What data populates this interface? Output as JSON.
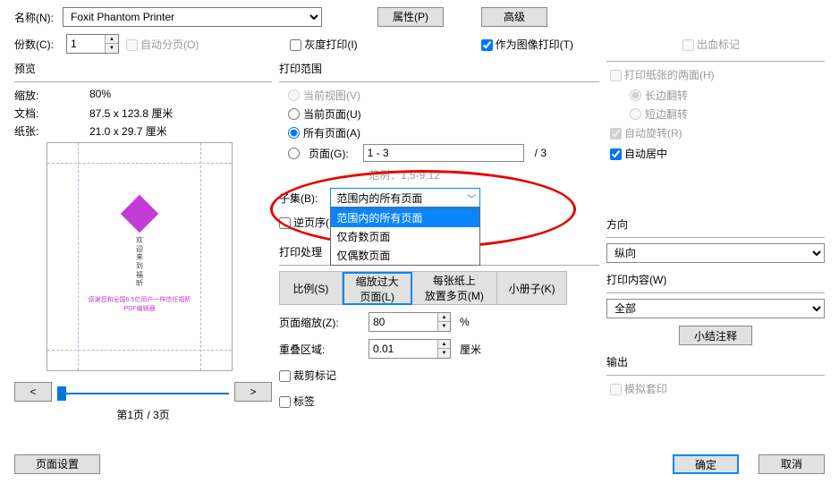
{
  "header": {
    "name_label": "名称(N):",
    "printer": "Foxit Phantom Printer",
    "properties_btn": "属性(P)",
    "advanced_btn": "高级",
    "copies_label": "份数(C):",
    "copies_value": "1",
    "collate_label": "自动分页(O)",
    "grayscale_label": "灰度打印(I)",
    "as_image_label": "作为图像打印(T)",
    "bleed_label": "出血标记"
  },
  "preview": {
    "title": "预览",
    "zoom_label": "缩放:",
    "zoom_value": "80%",
    "doc_label": "文档:",
    "doc_value": "87.5 x 123.8 厘米",
    "paper_label": "纸张:",
    "paper_value": "21.0 x 29.7 厘米",
    "nav_prev": "<",
    "nav_next": ">",
    "page_indicator": "第1页 / 3页"
  },
  "range": {
    "title": "打印范围",
    "current_view": "当前视图(V)",
    "current_page": "当前页面(U)",
    "all_pages": "所有页面(A)",
    "pages_label": "页面(G):",
    "pages_value": "1 - 3",
    "pages_total": "/ 3",
    "example_label": "范例：1,5-9,12",
    "subset_label": "子集(B):",
    "subset_selected": "范围内的所有页面",
    "subset_options": [
      "范围内的所有页面",
      "仅奇数页面",
      "仅偶数页面"
    ],
    "reverse_label": "逆页序(E)"
  },
  "handling": {
    "title": "打印处理",
    "tab_scale": "比例(S)",
    "tab_fit": "缩放过大\n页面(L)",
    "tab_multi": "每张纸上\n放置多页(M)",
    "tab_booklet": "小册子(K)",
    "page_zoom_label": "页面缩放(Z):",
    "page_zoom_value": "80",
    "page_zoom_unit": "%",
    "overlap_label": "重叠区域:",
    "overlap_value": "0.01",
    "overlap_unit": "厘米",
    "crop_label": "裁剪标记",
    "tags_label": "标签"
  },
  "duplex": {
    "both_sides": "打印纸张的两面(H)",
    "long_edge": "长边翻转",
    "short_edge": "短边翻转",
    "auto_rotate": "自动旋转(R)",
    "auto_center": "自动居中"
  },
  "orientation": {
    "title": "方向",
    "value": "纵向"
  },
  "what": {
    "title": "打印内容(W)",
    "value": "全部",
    "summarize_btn": "小结注释"
  },
  "output": {
    "title": "输出",
    "simulate": "模拟套印"
  },
  "footer": {
    "page_setup": "页面设置",
    "ok": "确定",
    "cancel": "取消"
  }
}
